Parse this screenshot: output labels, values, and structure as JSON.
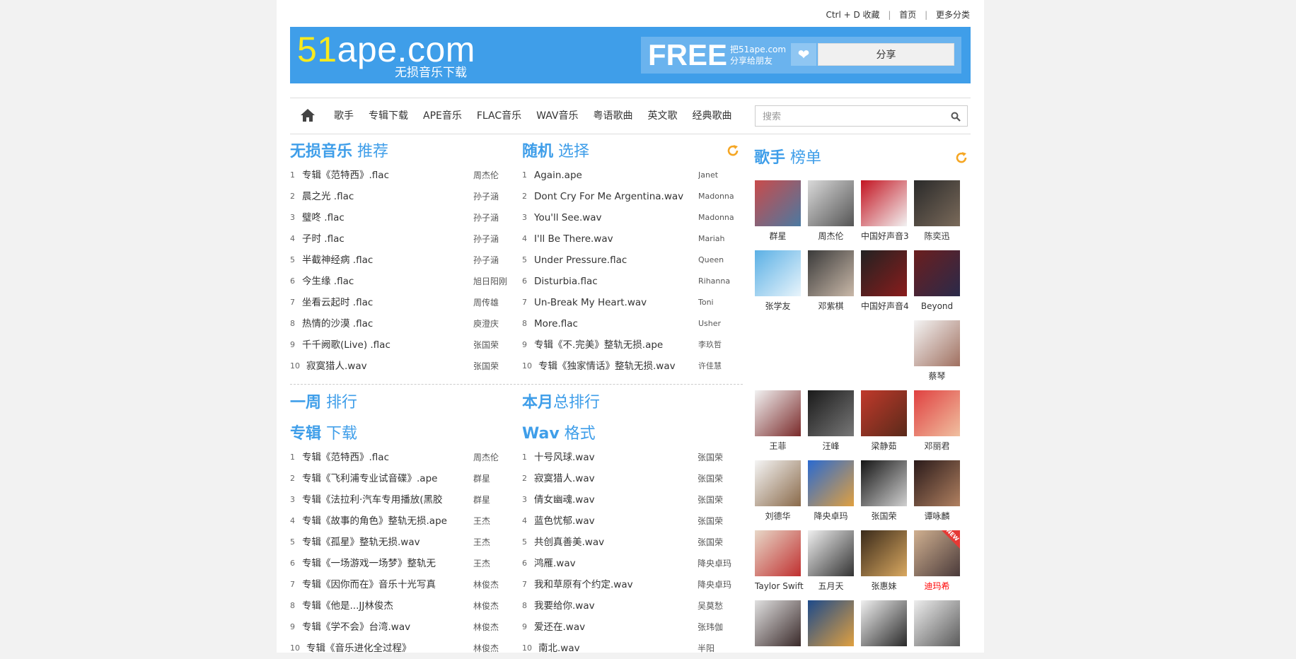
{
  "topbar": {
    "bookmark": "Ctrl + D 收藏",
    "home": "首页",
    "more": "更多分类"
  },
  "header": {
    "logo_digits": "51",
    "logo_rest": "ape.com",
    "logo_sub": "无损音乐下载",
    "free": "FREE",
    "share_line1": "把51ape.com",
    "share_line2": "分享给朋友",
    "share_button": "分享"
  },
  "nav": {
    "items": [
      "歌手",
      "专辑下载",
      "APE音乐",
      "FLAC音乐",
      "WAV音乐",
      "粤语歌曲",
      "英文歌",
      "经典歌曲"
    ],
    "search_placeholder": "搜索"
  },
  "sections": {
    "lossless": {
      "bold": "无损音乐",
      "rest": " 推荐"
    },
    "random": {
      "bold": "随机",
      "rest": " 选择"
    },
    "singers": {
      "bold": "歌手",
      "rest": " 榜单"
    },
    "week": {
      "bold": "一周",
      "rest": " 排行"
    },
    "month": {
      "bold": "本月",
      "rest": "总排行"
    },
    "album": {
      "bold": "专辑",
      "rest": " 下载"
    },
    "wav": {
      "bold": "Wav",
      "rest": " 格式"
    }
  },
  "lossless_list": [
    {
      "n": "1",
      "song": "专辑《范特西》.flac",
      "artist": "周杰伦"
    },
    {
      "n": "2",
      "song": "晨之光 .flac",
      "artist": "孙子涵"
    },
    {
      "n": "3",
      "song": "璧咚 .flac",
      "artist": "孙子涵"
    },
    {
      "n": "4",
      "song": "子时 .flac",
      "artist": "孙子涵"
    },
    {
      "n": "5",
      "song": "半截神经病 .flac",
      "artist": "孙子涵"
    },
    {
      "n": "6",
      "song": "今生缘 .flac",
      "artist": "旭日阳刚"
    },
    {
      "n": "7",
      "song": "坐看云起时 .flac",
      "artist": "周传雄"
    },
    {
      "n": "8",
      "song": "热情的沙漠 .flac",
      "artist": "庾澄庆"
    },
    {
      "n": "9",
      "song": "千千阙歌(Live) .flac",
      "artist": "张国荣"
    },
    {
      "n": "10",
      "song": "寂寞猎人.wav",
      "artist": "张国荣"
    }
  ],
  "random_list": [
    {
      "n": "1",
      "song": "Again.ape",
      "artist": "Janet"
    },
    {
      "n": "2",
      "song": "Dont Cry For Me Argentina.wav",
      "artist": "Madonna"
    },
    {
      "n": "3",
      "song": "You'll See.wav",
      "artist": "Madonna"
    },
    {
      "n": "4",
      "song": "I'll Be There.wav",
      "artist": "Mariah"
    },
    {
      "n": "5",
      "song": "Under Pressure.flac",
      "artist": "Queen"
    },
    {
      "n": "6",
      "song": "Disturbia.flac",
      "artist": "Rihanna"
    },
    {
      "n": "7",
      "song": "Un-Break My Heart.wav",
      "artist": "Toni"
    },
    {
      "n": "8",
      "song": "More.flac",
      "artist": "Usher"
    },
    {
      "n": "9",
      "song": "专辑《不.完美》整轨无损.ape",
      "artist": "李玖哲"
    },
    {
      "n": "10",
      "song": "专辑《独家情话》整轨无损.wav",
      "artist": "许佳慧"
    }
  ],
  "album_list": [
    {
      "n": "1",
      "song": "专辑《范特西》.flac",
      "artist": "周杰伦"
    },
    {
      "n": "2",
      "song": "专辑《飞利浦专业试音碟》.ape",
      "artist": "群星"
    },
    {
      "n": "3",
      "song": "专辑《法拉利·汽车专用播放(黑胶",
      "artist": "群星"
    },
    {
      "n": "4",
      "song": "专辑《故事的角色》整轨无损.ape",
      "artist": "王杰"
    },
    {
      "n": "5",
      "song": "专辑《孤星》整轨无损.wav",
      "artist": "王杰"
    },
    {
      "n": "6",
      "song": "专辑《一场游戏一场梦》整轨无",
      "artist": "王杰"
    },
    {
      "n": "7",
      "song": "专辑《因你而在》音乐十光写真",
      "artist": "林俊杰"
    },
    {
      "n": "8",
      "song": "专辑《他是...JJ林俊杰",
      "artist": "林俊杰"
    },
    {
      "n": "9",
      "song": "专辑《学不会》台湾.wav",
      "artist": "林俊杰"
    },
    {
      "n": "10",
      "song": "专辑《音乐进化全过程》",
      "artist": "林俊杰"
    }
  ],
  "wav_list": [
    {
      "n": "1",
      "song": "十号风球.wav",
      "artist": "张国荣"
    },
    {
      "n": "2",
      "song": "寂寞猎人.wav",
      "artist": "张国荣"
    },
    {
      "n": "3",
      "song": "倩女幽魂.wav",
      "artist": "张国荣"
    },
    {
      "n": "4",
      "song": "蓝色忧郁.wav",
      "artist": "张国荣"
    },
    {
      "n": "5",
      "song": "共创真善美.wav",
      "artist": "张国荣"
    },
    {
      "n": "6",
      "song": "鸿雁.wav",
      "artist": "降央卓玛"
    },
    {
      "n": "7",
      "song": "我和草原有个约定.wav",
      "artist": "降央卓玛"
    },
    {
      "n": "8",
      "song": "我要给你.wav",
      "artist": "吴莫愁"
    },
    {
      "n": "9",
      "song": "爱还在.wav",
      "artist": "张玮伽"
    },
    {
      "n": "10",
      "song": "南北.wav",
      "artist": "半阳"
    }
  ],
  "singers": [
    {
      "name": "群星",
      "c1": "#c94b4b",
      "c2": "#4b79a1"
    },
    {
      "name": "周杰伦",
      "c1": "#d9d9d9",
      "c2": "#555555"
    },
    {
      "name": "中国好声音3",
      "c1": "#c31421",
      "c2": "#f2f2f2"
    },
    {
      "name": "陈奕迅",
      "c1": "#2a2a2a",
      "c2": "#7a6a5a"
    },
    {
      "name": "张学友",
      "c1": "#5bb0e5",
      "c2": "#e8f4fb"
    },
    {
      "name": "邓紫棋",
      "c1": "#3a3a3a",
      "c2": "#c9b8a8"
    },
    {
      "name": "中国好声音4",
      "c1": "#222222",
      "c2": "#8a1c1c"
    },
    {
      "name": "Beyond",
      "c1": "#6b1e1e",
      "c2": "#2a2a4a"
    },
    {
      "name": "蔡琴",
      "c1": "#f4f4f4",
      "c2": "#a07060"
    },
    {
      "name": "王菲",
      "c1": "#f2f2f2",
      "c2": "#7a2a2a"
    },
    {
      "name": "汪峰",
      "c1": "#1a1a1a",
      "c2": "#777777"
    },
    {
      "name": "梁静茹",
      "c1": "#c0392b",
      "c2": "#5a2a1a"
    },
    {
      "name": "邓丽君",
      "c1": "#e04040",
      "c2": "#f0c0a0"
    },
    {
      "name": "刘德华",
      "c1": "#f5f5f5",
      "c2": "#8a6a4a"
    },
    {
      "name": "降央卓玛",
      "c1": "#2a6ad0",
      "c2": "#e0a040"
    },
    {
      "name": "张国荣",
      "c1": "#151515",
      "c2": "#d0d0d0"
    },
    {
      "name": "谭咏麟",
      "c1": "#2a1a1a",
      "c2": "#b08060"
    },
    {
      "name": "Taylor Swift",
      "c1": "#e8d8c8",
      "c2": "#c03030"
    },
    {
      "name": "五月天",
      "c1": "#f0f0f0",
      "c2": "#333333"
    },
    {
      "name": "张惠妹",
      "c1": "#3a2a1a",
      "c2": "#d9a860"
    },
    {
      "name": "迪玛希",
      "c1": "#d0b090",
      "c2": "#4a3a3a"
    },
    {
      "name": "",
      "c1": "#e0e0e0",
      "c2": "#3a2a2a"
    },
    {
      "name": "",
      "c1": "#1d4a8a",
      "c2": "#e0a040"
    },
    {
      "name": "",
      "c1": "#f0f0f0",
      "c2": "#2a2a2a"
    },
    {
      "name": "",
      "c1": "#ededed",
      "c2": "#5a5a5a"
    }
  ],
  "colors": {
    "accent": "#3f9ee9",
    "logo_yellow": "#f9ea1d",
    "refresh": "#f5a623",
    "new_badge": "#e53935",
    "highlight_name": "#ff0000"
  },
  "badge": {
    "new": "NEW"
  }
}
